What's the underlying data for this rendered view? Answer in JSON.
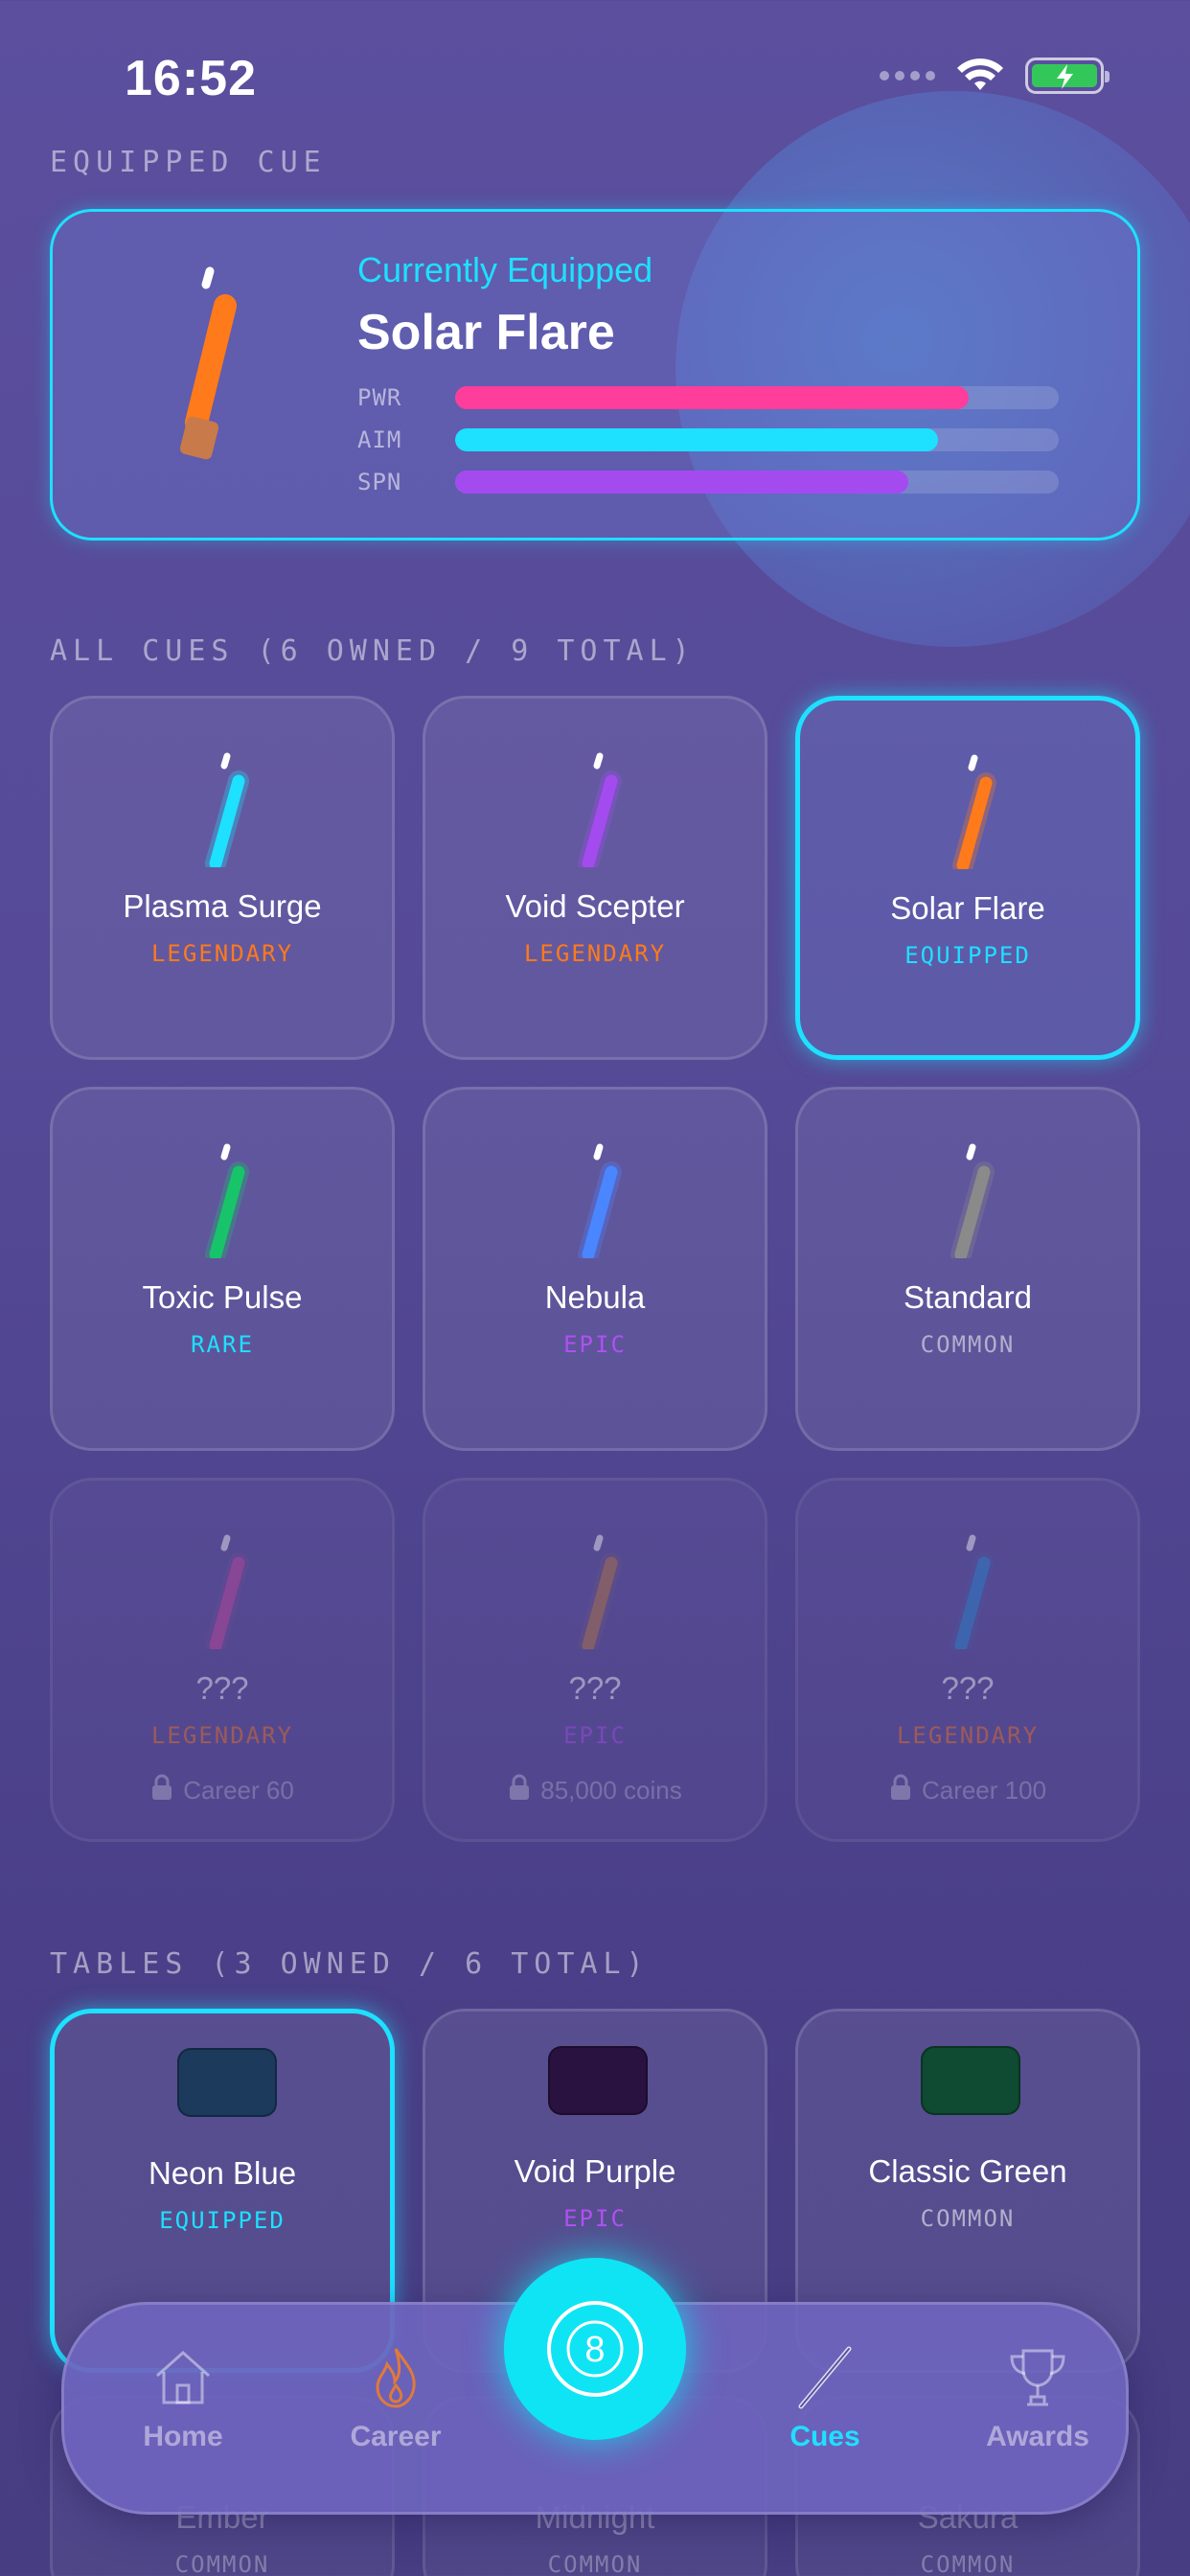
{
  "status_bar": {
    "time": "16:52"
  },
  "equipped": {
    "section_title": "EQUIPPED CUE",
    "subtitle": "Currently Equipped",
    "name": "Solar Flare",
    "stats": [
      {
        "label": "PWR",
        "value": 0.85,
        "color": "#ff3d9a"
      },
      {
        "label": "AIM",
        "value": 0.8,
        "color": "#1ee0ff"
      },
      {
        "label": "SPN",
        "value": 0.75,
        "color": "#a44bf0"
      }
    ]
  },
  "cues": {
    "section_title": "ALL CUES (6 OWNED / 9 TOTAL)",
    "items": [
      {
        "name": "Plasma Surge",
        "rarity": "LEGENDARY",
        "rarity_color": "#ff7a1a",
        "cue_color": "#1ee0ff"
      },
      {
        "name": "Void Scepter",
        "rarity": "LEGENDARY",
        "rarity_color": "#ff7a1a",
        "cue_color": "#a44bf0"
      },
      {
        "name": "Solar Flare",
        "rarity": "EQUIPPED",
        "rarity_color": "#1ee0ff",
        "cue_color": "#ff7a1a",
        "selected": true
      },
      {
        "name": "Toxic Pulse",
        "rarity": "RARE",
        "rarity_color": "#1ee0ff",
        "cue_color": "#17c46a"
      },
      {
        "name": "Nebula",
        "rarity": "EPIC",
        "rarity_color": "#b050f0",
        "cue_color": "#4a86ff"
      },
      {
        "name": "Standard",
        "rarity": "COMMON",
        "rarity_color": "#b0b0cc",
        "cue_color": "#8a8a8a"
      },
      {
        "name": "???",
        "rarity": "LEGENDARY",
        "rarity_color": "#ff7a1a",
        "cue_color": "#d04aa0",
        "locked": true,
        "requirement": "Career 60"
      },
      {
        "name": "???",
        "rarity": "EPIC",
        "rarity_color": "#b050f0",
        "cue_color": "#c08040",
        "locked": true,
        "requirement": "85,000 coins"
      },
      {
        "name": "???",
        "rarity": "LEGENDARY",
        "rarity_color": "#ff7a1a",
        "cue_color": "#2a90d8",
        "locked": true,
        "requirement": "Career 100"
      }
    ]
  },
  "tables": {
    "section_title": "TABLES (3 OWNED / 6 TOTAL)",
    "items": [
      {
        "name": "Neon Blue",
        "rarity": "EQUIPPED",
        "rarity_color": "#1ee0ff",
        "felt_color": "#1b3a5c",
        "selected": true
      },
      {
        "name": "Void Purple",
        "rarity": "EPIC",
        "rarity_color": "#b050f0",
        "felt_color": "#2a1240"
      },
      {
        "name": "Classic Green",
        "rarity": "COMMON",
        "rarity_color": "#b0b0cc",
        "felt_color": "#0f4a32"
      },
      {
        "name": "Ember",
        "rarity": "COMMON"
      },
      {
        "name": "Midnight",
        "rarity": "COMMON"
      },
      {
        "name": "Sakura",
        "rarity": "COMMON"
      }
    ]
  },
  "tab_bar": {
    "items": [
      {
        "label": "Home",
        "icon": "home-icon"
      },
      {
        "label": "Career",
        "icon": "flame-icon"
      },
      {
        "label": "Cues",
        "icon": "cue-icon",
        "active": true
      },
      {
        "label": "Awards",
        "icon": "trophy-icon"
      }
    ],
    "play_button_label": "8"
  }
}
